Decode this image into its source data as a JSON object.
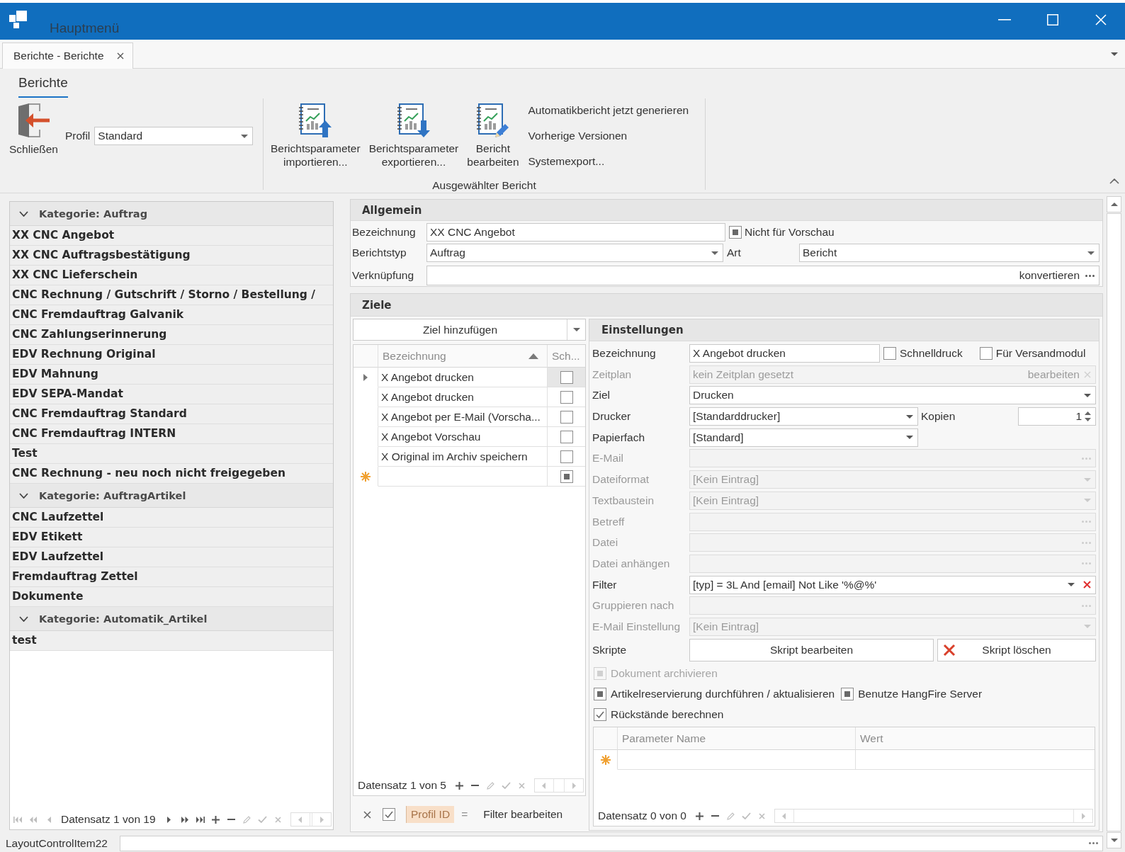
{
  "window": {
    "title": "Hauptmenü"
  },
  "document_tabs": [
    {
      "label": "Berichte - Berichte",
      "selected": true
    }
  ],
  "ribbon": {
    "tabs": [
      {
        "label": "Berichte",
        "selected": true
      }
    ],
    "exit_button": {
      "label": "Schließen"
    },
    "profile": {
      "label": "Profil",
      "value": "Standard"
    },
    "report_group": {
      "caption": "Ausgewählter Bericht",
      "large_buttons": [
        {
          "kind": "import",
          "label": "Berichtsparameter importieren..."
        },
        {
          "kind": "export",
          "label": "Berichtsparameter exportieren..."
        },
        {
          "kind": "edit",
          "label": "Bericht bearbeiten"
        }
      ],
      "small_buttons": [
        {
          "label": "Automatikbericht jetzt generieren"
        },
        {
          "label": "Vorherige Versionen"
        },
        {
          "label": "Systemexport..."
        }
      ]
    }
  },
  "report_list": {
    "groups": [
      {
        "caption": "Kategorie: Auftrag",
        "expanded": true,
        "items": [
          "XX CNC Angebot",
          "XX CNC Auftragsbestätigung",
          "XX CNC Lieferschein",
          "CNC Rechnung / Gutschrift / Storno / Bestellung /",
          "CNC Fremdauftrag Galvanik",
          "CNC Zahlungserinnerung",
          "EDV Rechnung Original",
          "EDV Mahnung",
          "EDV SEPA-Mandat",
          "CNC Fremdauftrag Standard",
          "CNC Fremdauftrag INTERN",
          "Test",
          "CNC Rechnung - neu noch nicht freigegeben"
        ]
      },
      {
        "caption": "Kategorie: AuftragArtikel",
        "expanded": true,
        "items": [
          "CNC Laufzettel",
          "EDV Etikett",
          "EDV Laufzettel",
          "Fremdauftrag Zettel",
          "Dokumente"
        ]
      },
      {
        "caption": "Kategorie: Automatik_Artikel",
        "expanded": true,
        "items": [
          "test"
        ]
      }
    ],
    "navigator": {
      "counter": "Datensatz 1 von 19",
      "buttons": [
        {
          "kind": "first",
          "disabled": true
        },
        {
          "kind": "prev_page",
          "disabled": true
        },
        {
          "kind": "prev",
          "disabled": true
        },
        {
          "kind": "next",
          "disabled": false
        },
        {
          "kind": "next_page",
          "disabled": false
        },
        {
          "kind": "last",
          "disabled": false
        },
        {
          "kind": "append",
          "disabled": false
        },
        {
          "kind": "remove",
          "disabled": false
        },
        {
          "kind": "edit",
          "disabled": true
        },
        {
          "kind": "end_edit",
          "disabled": true
        },
        {
          "kind": "cancel_edit",
          "disabled": true
        }
      ]
    }
  },
  "general": {
    "caption": "Allgemein",
    "name": {
      "label": "Bezeichnung",
      "value": "XX CNC Angebot"
    },
    "preview_option": {
      "label": "Nicht für Vorschau",
      "indeterminate": true
    },
    "report_type": {
      "label": "Berichtstyp",
      "value": "Auftrag"
    },
    "type": {
      "label": "Art",
      "value": "Bericht"
    },
    "link": {
      "label": "Verknüpfung",
      "button": "konvertieren"
    }
  },
  "targets": {
    "caption": "Ziele",
    "add_button": {
      "label": "Ziel hinzufügen"
    },
    "grid": {
      "columns": [
        {
          "label": "Bezeichnung",
          "sorted": true
        },
        {
          "label": "Sch...",
          "sorted": false
        }
      ],
      "rows": [
        {
          "name": "X Angebot drucken",
          "checked": false,
          "selected": true
        },
        {
          "name": "X Angebot drucken",
          "checked": false,
          "selected": false
        },
        {
          "name": "X Angebot per E-Mail (Vorscha...",
          "checked": false,
          "selected": false
        },
        {
          "name": "X Angebot Vorschau",
          "checked": false,
          "selected": false
        },
        {
          "name": "X Original im Archiv speichern",
          "checked": false,
          "selected": false
        }
      ],
      "new_row": {
        "indeterminate": true
      }
    },
    "navigator": {
      "counter": "Datensatz 1 von 5",
      "buttons": [
        {
          "kind": "append",
          "disabled": false
        },
        {
          "kind": "remove",
          "disabled": false
        },
        {
          "kind": "edit",
          "disabled": true
        },
        {
          "kind": "end_edit",
          "disabled": true
        },
        {
          "kind": "cancel_edit",
          "disabled": true
        }
      ]
    },
    "filter": {
      "enabled": true,
      "field": "Profil ID",
      "operator": "=",
      "edit_label": "Filter bearbeiten"
    }
  },
  "settings": {
    "caption": "Einstellungen",
    "rows": [
      {
        "kind": "text",
        "label": "Bezeichnung",
        "value": "X Angebot drucken",
        "disabled": false,
        "options": [
          {
            "label": "Schnelldruck",
            "checked": false
          },
          {
            "label": "Für Versandmodul",
            "checked": false
          }
        ]
      },
      {
        "kind": "schedule",
        "label": "Zeitplan",
        "placeholder": "kein Zeitplan gesetzt",
        "button": "bearbeiten",
        "disabled": true
      },
      {
        "kind": "combo",
        "label": "Ziel",
        "value": "Drucken",
        "disabled": false
      },
      {
        "kind": "combo_spin",
        "label": "Drucker",
        "value": "[Standarddrucker]",
        "spin_label": "Kopien",
        "spin_value": "1",
        "disabled": false
      },
      {
        "kind": "combo_half",
        "label": "Papierfach",
        "value": "[Standard]",
        "disabled": false
      },
      {
        "kind": "ellipsis",
        "label": "E-Mail",
        "disabled": true
      },
      {
        "kind": "combo",
        "label": "Dateiformat",
        "value": "[Kein Eintrag]",
        "disabled": true
      },
      {
        "kind": "combo",
        "label": "Textbaustein",
        "value": "[Kein Eintrag]",
        "disabled": true
      },
      {
        "kind": "ellipsis",
        "label": "Betreff",
        "disabled": true
      },
      {
        "kind": "ellipsis",
        "label": "Datei",
        "disabled": true
      },
      {
        "kind": "ellipsis",
        "label": "Datei anhängen",
        "disabled": true
      },
      {
        "kind": "filter",
        "label": "Filter",
        "value": "[typ] = 3L And [email] Not Like '%@%'",
        "disabled": false
      },
      {
        "kind": "ellipsis",
        "label": "Gruppieren nach",
        "disabled": true
      },
      {
        "kind": "combo",
        "label": "E-Mail Einstellung",
        "value": "[Kein Eintrag]",
        "disabled": true
      },
      {
        "kind": "buttons",
        "label": "Skripte",
        "disabled": false,
        "buttons": [
          {
            "kind": "plain",
            "label": "Skript bearbeiten"
          },
          {
            "kind": "delete",
            "label": "Skript löschen"
          }
        ]
      }
    ],
    "option_rows": [
      {
        "items": [
          {
            "label": "Dokument archivieren",
            "indeterminate": true,
            "disabled": true
          }
        ]
      },
      {
        "items": [
          {
            "label": "Artikelreservierung durchführen / aktualisieren",
            "indeterminate": true,
            "disabled": false
          },
          {
            "label": "Benutze HangFire Server",
            "indeterminate": true,
            "disabled": false
          }
        ]
      },
      {
        "items": [
          {
            "label": "Rückstände berechnen",
            "checked": true,
            "indeterminate": false,
            "disabled": false
          }
        ]
      }
    ],
    "parameters": {
      "columns": [
        {
          "label": "Parameter Name"
        },
        {
          "label": "Wert"
        }
      ],
      "new_row": true,
      "navigator": {
        "counter": "Datensatz 0 von 0",
        "buttons": [
          {
            "kind": "append",
            "disabled": false
          },
          {
            "kind": "remove",
            "disabled": false
          },
          {
            "kind": "edit",
            "disabled": true
          },
          {
            "kind": "end_edit",
            "disabled": true
          },
          {
            "kind": "cancel_edit",
            "disabled": true
          }
        ]
      }
    }
  },
  "layout_item": {
    "label": "LayoutControlItem22"
  }
}
